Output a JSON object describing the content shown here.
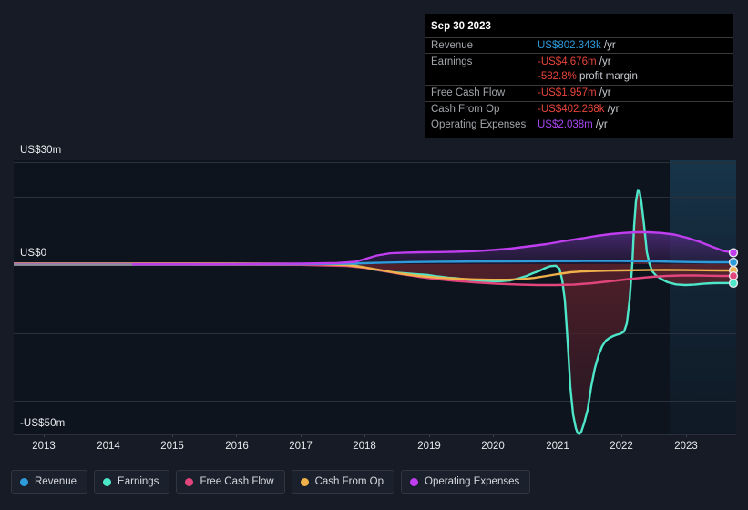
{
  "chart_data": {
    "type": "line",
    "title": "",
    "xlabel": "",
    "ylabel": "",
    "currency": "US$",
    "grid": true,
    "legend_position": "bottom",
    "ylim": [
      -50,
      30
    ],
    "ytick_labels": [
      "US$30m",
      "US$0",
      "-US$50m"
    ],
    "ytick_values": [
      30,
      0,
      -50
    ],
    "xlim": [
      2012.5,
      2023.9
    ],
    "categories": [
      2013,
      2014,
      2015,
      2016,
      2017,
      2018,
      2019,
      2020,
      2021,
      2022,
      2023
    ],
    "xtick_labels": [
      "2013",
      "2014",
      "2015",
      "2016",
      "2017",
      "2018",
      "2019",
      "2020",
      "2021",
      "2022",
      "2023"
    ],
    "forecast_band_start": 2022.55,
    "series": [
      {
        "name": "Revenue",
        "color": "#2e9bdb",
        "values": [
          0.1,
          0.1,
          0.1,
          0.12,
          0.15,
          0.3,
          0.9,
          1.2,
          1.4,
          1.1,
          0.8
        ]
      },
      {
        "name": "Earnings",
        "color": "#4de6c8",
        "values": [
          0.0,
          0.0,
          0.0,
          -0.1,
          -0.2,
          -1.2,
          -2.6,
          -2.2,
          -49.5,
          29.0,
          -4.7
        ]
      },
      {
        "name": "Free Cash Flow",
        "color": "#e0457b",
        "values": [
          0.0,
          0.0,
          0.0,
          -0.1,
          -0.2,
          -1.0,
          -3.6,
          -4.2,
          -3.2,
          -2.5,
          -2.0
        ]
      },
      {
        "name": "Cash From Op",
        "color": "#f0b04a",
        "values": [
          0.05,
          0.05,
          0.05,
          0.0,
          -0.1,
          -0.9,
          -2.9,
          -3.4,
          -1.1,
          -0.9,
          -0.4
        ]
      },
      {
        "name": "Operating Expenses",
        "color": "#c03ef0",
        "values": [
          0.0,
          0.0,
          0.0,
          0.0,
          0.0,
          1.4,
          2.6,
          4.2,
          6.2,
          3.6,
          2.0
        ]
      }
    ]
  },
  "tooltip": {
    "title": "Sep 30 2023",
    "rows": [
      {
        "label": "Revenue",
        "amount": "US$802.343k",
        "unit": " /yr",
        "color": "#2e9bdb"
      },
      {
        "label": "Earnings",
        "amount": "-US$4.676m",
        "unit": " /yr",
        "color": "#e8453c"
      },
      {
        "label": "",
        "amount": "-582.8%",
        "unit": " profit margin",
        "color": "#e8453c"
      },
      {
        "label": "Free Cash Flow",
        "amount": "-US$1.957m",
        "unit": " /yr",
        "color": "#e8453c"
      },
      {
        "label": "Cash From Op",
        "amount": "-US$402.268k",
        "unit": " /yr",
        "color": "#e8453c"
      },
      {
        "label": "Operating Expenses",
        "amount": "US$2.038m",
        "unit": " /yr",
        "color": "#aa47f5"
      }
    ]
  },
  "legend": {
    "items": [
      {
        "label": "Revenue",
        "color": "#2e9bdb"
      },
      {
        "label": "Earnings",
        "color": "#4de6c8"
      },
      {
        "label": "Free Cash Flow",
        "color": "#e0457b"
      },
      {
        "label": "Cash From Op",
        "color": "#f0b04a"
      },
      {
        "label": "Operating Expenses",
        "color": "#c03ef0"
      }
    ]
  },
  "theme": {
    "background": "#161b25",
    "plot_background": "#0e141e",
    "gridline": "#2b313c",
    "zero_line": "#8b9199",
    "axis_text": "#e8eaed"
  }
}
